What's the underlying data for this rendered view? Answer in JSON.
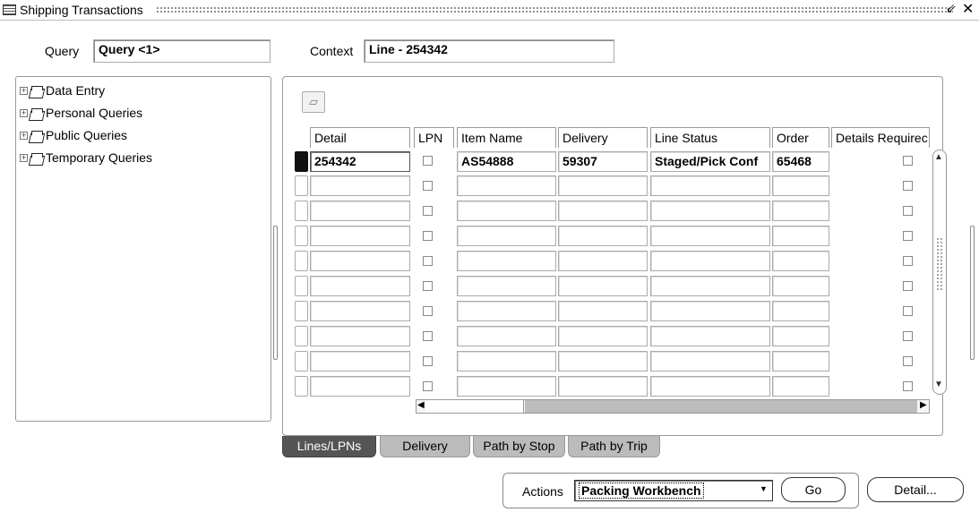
{
  "window": {
    "title": "Shipping Transactions",
    "controls": [
      "minimize-icon",
      "close-icon"
    ]
  },
  "header": {
    "query_label": "Query",
    "query_value": "Query <1>",
    "context_label": "Context",
    "context_value": "Line - 254342"
  },
  "tree": {
    "items": [
      {
        "label": "Data Entry",
        "icon": "folder-icon"
      },
      {
        "label": "Personal Queries",
        "icon": "folder-icon"
      },
      {
        "label": "Public Queries",
        "icon": "folder-icon"
      },
      {
        "label": "Temporary Queries",
        "icon": "folder-icon"
      }
    ]
  },
  "table": {
    "columns": [
      "Detail",
      "LPN",
      "Item Name",
      "Delivery",
      "Line Status",
      "Order",
      "Details Requirec"
    ],
    "rows": [
      {
        "detail": "254342",
        "lpn": false,
        "item_name": "AS54888",
        "delivery": "59307",
        "line_status": "Staged/Pick Conf",
        "order": "65468",
        "details_required": false
      },
      {
        "detail": "",
        "item_name": "",
        "delivery": "",
        "line_status": "",
        "order": ""
      },
      {
        "detail": "",
        "item_name": "",
        "delivery": "",
        "line_status": "",
        "order": ""
      },
      {
        "detail": "",
        "item_name": "",
        "delivery": "",
        "line_status": "",
        "order": ""
      },
      {
        "detail": "",
        "item_name": "",
        "delivery": "",
        "line_status": "",
        "order": ""
      },
      {
        "detail": "",
        "item_name": "",
        "delivery": "",
        "line_status": "",
        "order": ""
      },
      {
        "detail": "",
        "item_name": "",
        "delivery": "",
        "line_status": "",
        "order": ""
      },
      {
        "detail": "",
        "item_name": "",
        "delivery": "",
        "line_status": "",
        "order": ""
      },
      {
        "detail": "",
        "item_name": "",
        "delivery": "",
        "line_status": "",
        "order": ""
      },
      {
        "detail": "",
        "item_name": "",
        "delivery": "",
        "line_status": "",
        "order": ""
      }
    ]
  },
  "tabs": [
    {
      "label": "Lines/LPNs",
      "active": true
    },
    {
      "label": "Delivery",
      "active": false
    },
    {
      "label": "Path by Stop",
      "active": false
    },
    {
      "label": "Path by Trip",
      "active": false
    }
  ],
  "actions": {
    "label": "Actions",
    "selected": "Packing Workbench",
    "go_button": "Go",
    "detail_button": "Detail..."
  },
  "colors": {
    "active_tab": "#555555",
    "inactive_tab": "#bbbbbb",
    "current_row_marker": "#111111"
  }
}
